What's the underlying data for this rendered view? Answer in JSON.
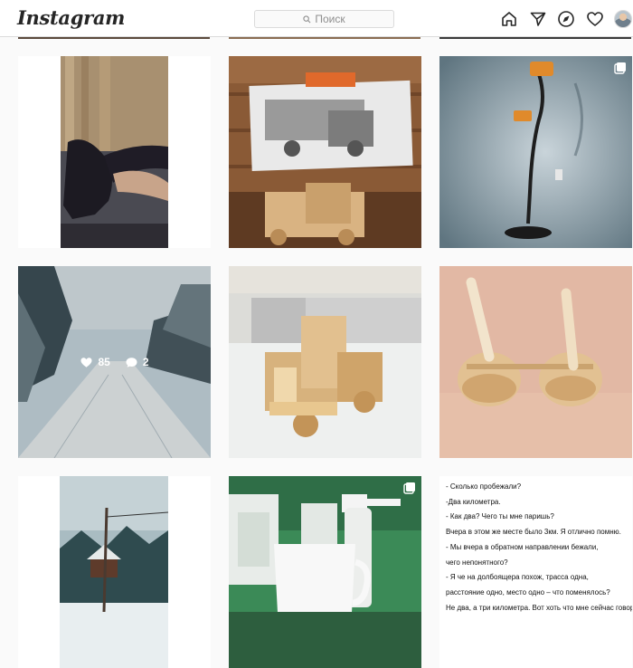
{
  "header": {
    "logo_text": "Instagram",
    "search_placeholder": "Поиск",
    "icons": [
      "home-icon",
      "direct-icon",
      "explore-icon",
      "activity-heart-icon",
      "profile-avatar"
    ]
  },
  "colors": {
    "header_bg": "#ffffff",
    "page_bg": "#fafafa",
    "border": "#dbdbdb",
    "muted_text": "#8e8e8e"
  },
  "grid": {
    "posts": [
      {
        "id": "post-1",
        "subject": "person doing exercise on floor",
        "multi": false
      },
      {
        "id": "post-2",
        "subject": "wooden toy truck with photo",
        "multi": false
      },
      {
        "id": "post-3",
        "subject": "metal detector against wall",
        "multi": true
      },
      {
        "id": "post-4",
        "subject": "snowy forest road",
        "multi": false,
        "likes": "85",
        "comments": "2"
      },
      {
        "id": "post-5",
        "subject": "wooden toy truck on table",
        "multi": false
      },
      {
        "id": "post-6",
        "subject": "wooden pegs on discs",
        "multi": false
      },
      {
        "id": "post-7",
        "subject": "winter village with power pole",
        "multi": false
      },
      {
        "id": "post-8",
        "subject": "mug and medicine bottles",
        "multi": true
      },
      {
        "id": "post-9",
        "subject": "text post",
        "multi": false
      }
    ],
    "text_post_lines": [
      "- Сколько пробежали?",
      "-Два километра.",
      "- Как два? Чего ты мне паришь?",
      "Вчера в этом же месте было 3км. Я отлично помню.",
      "- Мы вчера в обратном направлении бежали,",
      "чего непонятного?",
      "- Я че на долбоящера похож, трасса одна,",
      "расстояние одно, место одно – что поменялось?",
      "Не два, а три километра. Вот хоть что мне сейчас говори!"
    ]
  }
}
